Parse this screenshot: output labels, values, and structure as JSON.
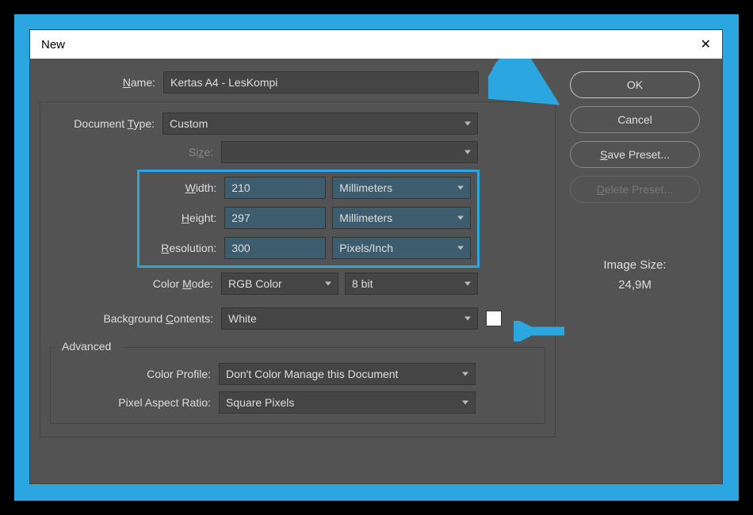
{
  "dialog": {
    "title": "New",
    "close_symbol": "✕"
  },
  "fields": {
    "name_label": "Name:",
    "name_value": "Kertas A4 - LesKompi",
    "doctype_label": "Document Type:",
    "doctype_value": "Custom",
    "size_label": "Size:",
    "size_value": "",
    "width_label": "Width:",
    "width_value": "210",
    "width_unit": "Millimeters",
    "height_label": "Height:",
    "height_value": "297",
    "height_unit": "Millimeters",
    "resolution_label": "Resolution:",
    "resolution_value": "300",
    "resolution_unit": "Pixels/Inch",
    "colormode_label": "Color Mode:",
    "colormode_value": "RGB Color",
    "colormode_depth": "8 bit",
    "bgcontents_label": "Background Contents:",
    "bgcontents_value": "White",
    "bgcontents_color": "#ffffff",
    "advanced_legend": "Advanced",
    "colorprofile_label": "Color Profile:",
    "colorprofile_value": "Don't Color Manage this Document",
    "pixelaspect_label": "Pixel Aspect Ratio:",
    "pixelaspect_value": "Square Pixels"
  },
  "buttons": {
    "ok": "OK",
    "cancel": "Cancel",
    "save_preset": "Save Preset...",
    "delete_preset": "Delete Preset..."
  },
  "image_size": {
    "label": "Image Size:",
    "value": "24,9M"
  },
  "annotation": {
    "arrow_color": "#2ca6de"
  }
}
